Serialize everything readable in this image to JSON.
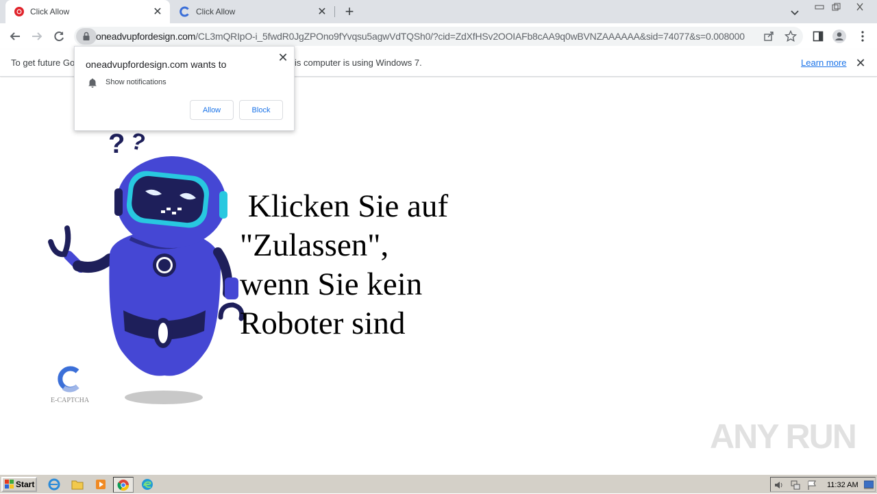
{
  "tabs": [
    {
      "title": "Click Allow",
      "active": true,
      "favicon": "opera-red-circle-icon"
    },
    {
      "title": "Click Allow",
      "active": false,
      "favicon": "captcha-c-icon"
    }
  ],
  "address_bar": {
    "host": "oneadvupfordesign.com",
    "path": "/CL3mQRIpO-i_5fwdR0JgZPOno9fYvqsu5agwVdTQSh0/?cid=ZdXfHSv2OOIAFb8cAA9q0wBVNZAAAAAA&sid=74077&s=0.008000"
  },
  "infobar": {
    "text_left": "To get future Go",
    "text_right": "is computer is using Windows 7.",
    "learn_more": "Learn more"
  },
  "permission_popup": {
    "title": "oneadvupfordesign.com wants to",
    "permission": "Show notifications",
    "allow_label": "Allow",
    "block_label": "Block"
  },
  "page": {
    "message": " Klicken Sie auf\n\"Zulassen\",\nwenn Sie kein\nRoboter sind",
    "captcha_label": "E-CAPTCHA",
    "watermark": "ANY RUN"
  },
  "taskbar": {
    "start_label": "Start",
    "clock": "11:32 AM"
  },
  "colors": {
    "robot_body": "#4547d4",
    "robot_dark": "#1e1f5a",
    "visor": "#28c8e0",
    "link": "#1a73e8"
  }
}
